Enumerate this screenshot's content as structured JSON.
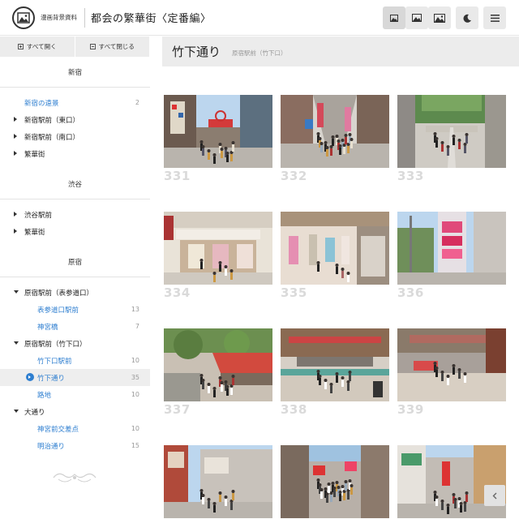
{
  "header": {
    "logo_text": "漫画背景資料",
    "site_title": "都会の繁華街〈定番編〉",
    "buttons": [
      {
        "name": "view-small-button",
        "icon": "image-small-icon"
      },
      {
        "name": "view-medium-button",
        "icon": "image-medium-icon"
      },
      {
        "name": "view-large-button",
        "icon": "image-large-icon"
      },
      {
        "name": "dark-mode-button",
        "icon": "moon-icon"
      },
      {
        "name": "menu-button",
        "icon": "hamburger-icon"
      }
    ]
  },
  "sidebar": {
    "expand_all": "すべて開く",
    "collapse_all": "すべて閉じる",
    "sections": [
      {
        "title": "新宿",
        "items": [
          {
            "label": "新宿の遠景",
            "count": "2",
            "level": 1,
            "caret": "none",
            "link": true
          },
          {
            "label": "新宿駅前（東口）",
            "level": 1,
            "caret": "right"
          },
          {
            "label": "新宿駅前（南口）",
            "level": 1,
            "caret": "right"
          },
          {
            "label": "繁華街",
            "level": 1,
            "caret": "right"
          }
        ]
      },
      {
        "title": "渋谷",
        "items": [
          {
            "label": "渋谷駅前",
            "level": 1,
            "caret": "right"
          },
          {
            "label": "繁華街",
            "level": 1,
            "caret": "right"
          }
        ]
      },
      {
        "title": "原宿",
        "items": [
          {
            "label": "原宿駅前（表参道口）",
            "level": 1,
            "caret": "down"
          },
          {
            "label": "表参道口駅前",
            "count": "13",
            "level": 2,
            "link": true
          },
          {
            "label": "神宮橋",
            "count": "7",
            "level": 2,
            "link": true
          },
          {
            "label": "原宿駅前（竹下口）",
            "level": 1,
            "caret": "down"
          },
          {
            "label": "竹下口駅前",
            "count": "10",
            "level": 2,
            "link": true
          },
          {
            "label": "竹下通り",
            "count": "35",
            "level": 2,
            "link": true,
            "selected": true
          },
          {
            "label": "路地",
            "count": "10",
            "level": 2,
            "link": true
          },
          {
            "label": "大通り",
            "level": 1,
            "caret": "down"
          },
          {
            "label": "神宮前交差点",
            "count": "10",
            "level": 2,
            "link": true
          },
          {
            "label": "明治通り",
            "count": "15",
            "level": 2,
            "link": true
          }
        ]
      }
    ]
  },
  "main": {
    "title": "竹下通り",
    "subtitle": "原宿駅前（竹下口）",
    "photos": [
      {
        "number": "331",
        "scene": "street-gate"
      },
      {
        "number": "332",
        "scene": "crowded-street"
      },
      {
        "number": "333",
        "scene": "station-plaza"
      },
      {
        "number": "334",
        "scene": "shopfront"
      },
      {
        "number": "335",
        "scene": "boutique"
      },
      {
        "number": "336",
        "scene": "signboards"
      },
      {
        "number": "337",
        "scene": "overhead-trees"
      },
      {
        "number": "338",
        "scene": "overhead-crossing"
      },
      {
        "number": "339",
        "scene": "overhead-plaza"
      },
      {
        "number": "",
        "scene": "street-left"
      },
      {
        "number": "",
        "scene": "street-crowd"
      },
      {
        "number": "",
        "scene": "street-right"
      }
    ]
  },
  "back_button_icon": "chevron-left-icon",
  "colors": {
    "link": "#2f7fd0",
    "number": "#dadada",
    "header_button": "#e9e9e9"
  }
}
